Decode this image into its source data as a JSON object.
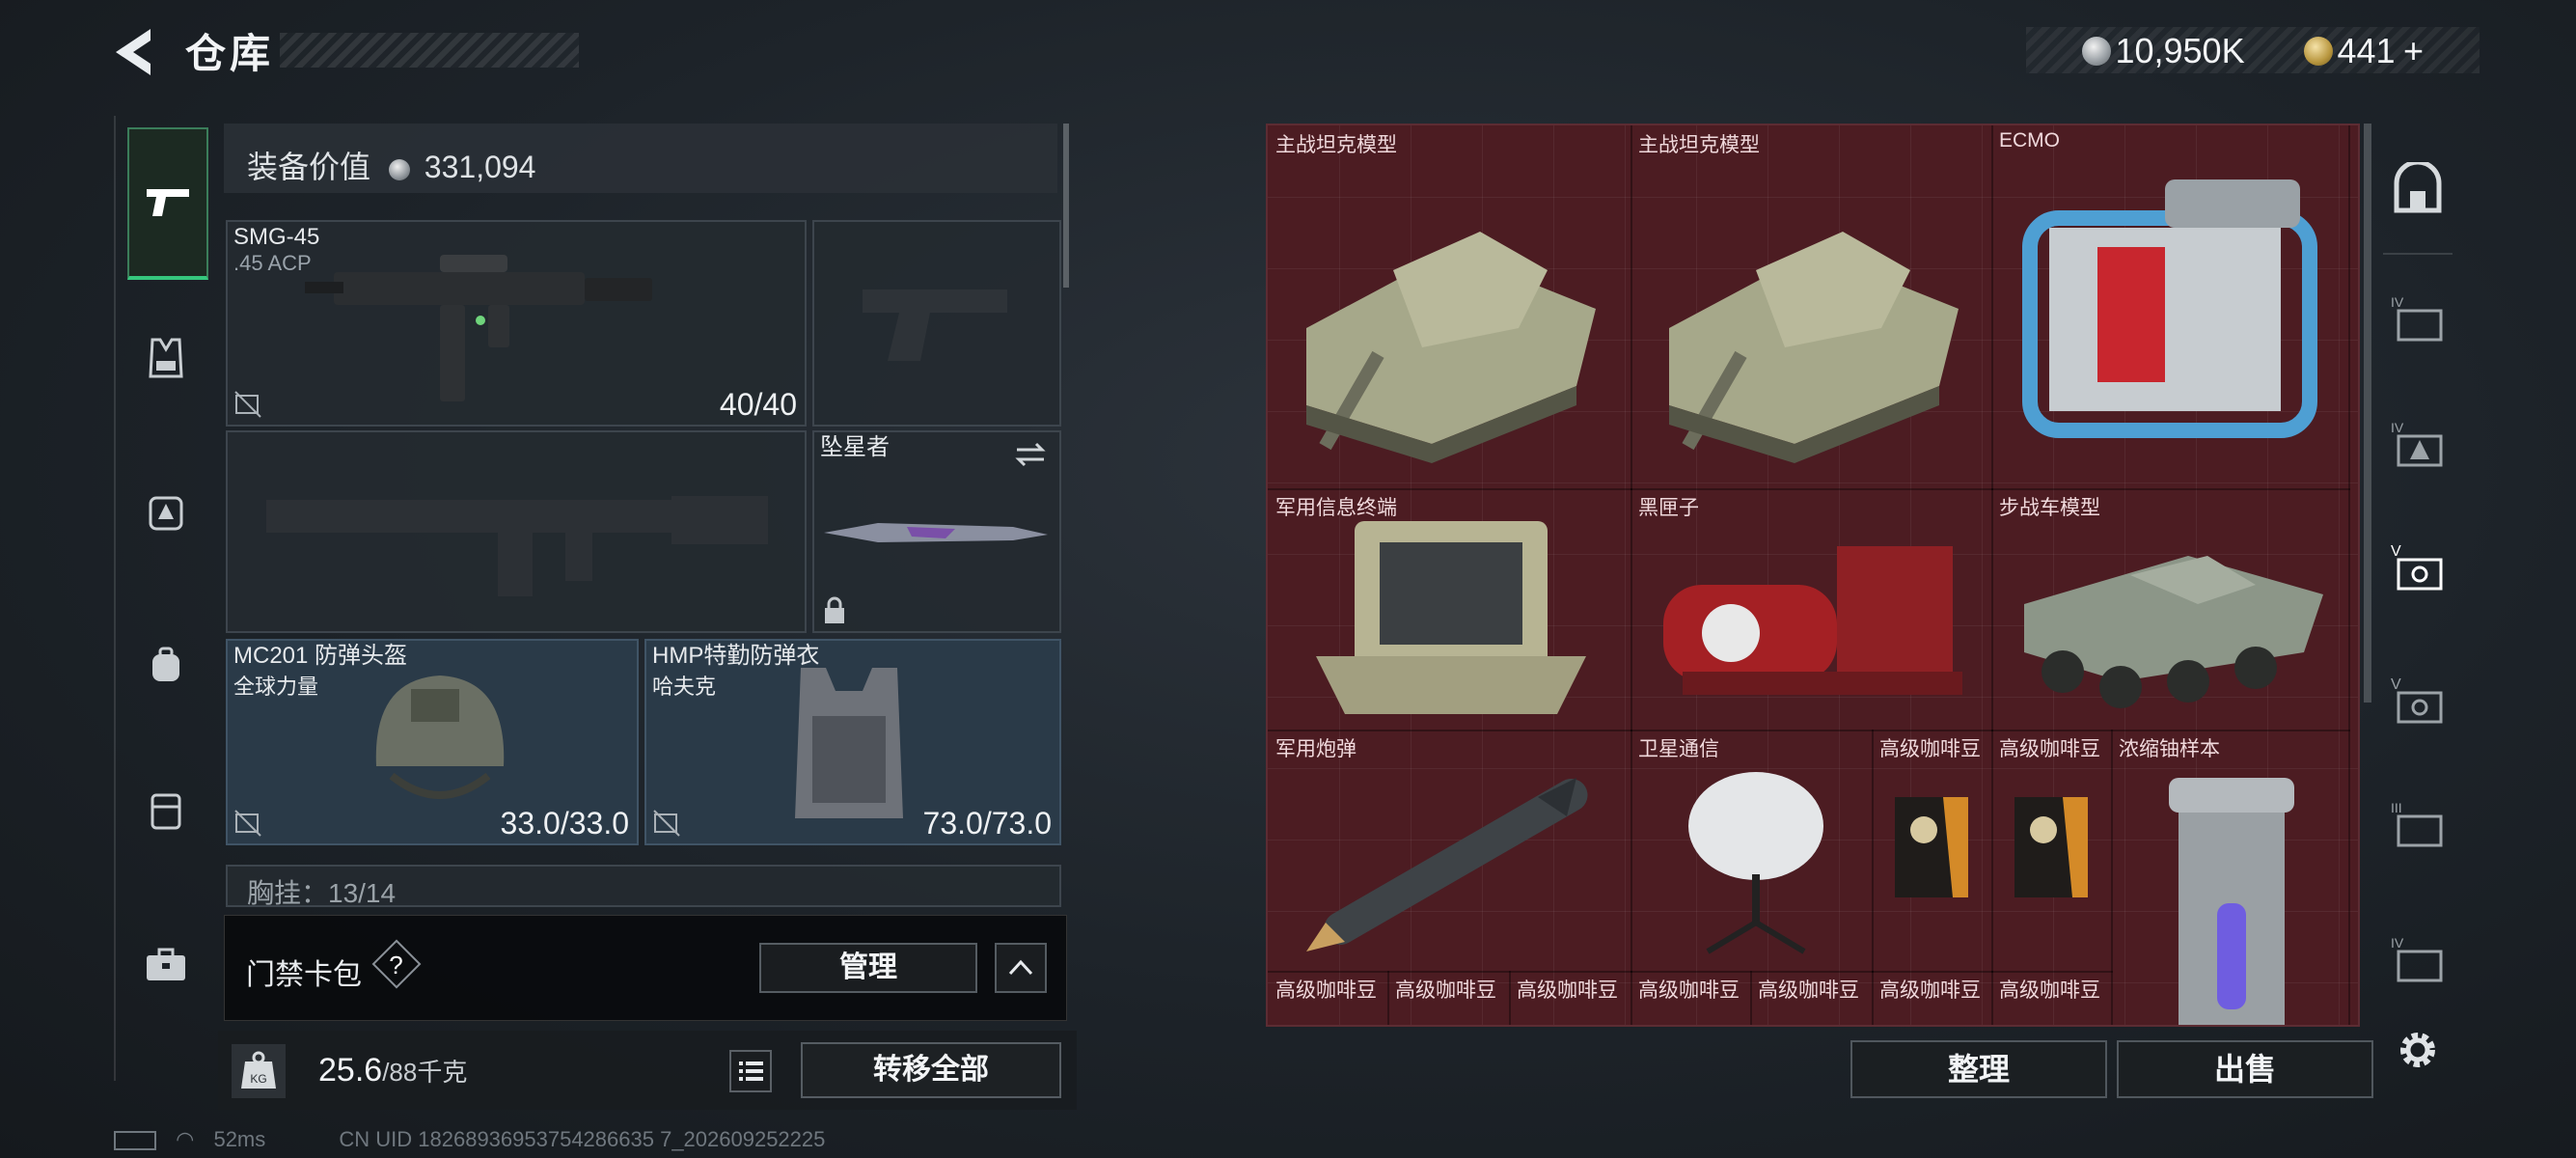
{
  "header": {
    "title": "仓库",
    "currencies": [
      {
        "icon": "silver-coin-icon",
        "value": "10,950K"
      },
      {
        "icon": "gold-triangle-coin-icon",
        "value": "441"
      }
    ],
    "add_label": "+"
  },
  "left_rail": {
    "items": [
      {
        "name": "pistol-icon",
        "active": true
      },
      {
        "name": "vest-icon"
      },
      {
        "name": "backpack-warning-icon"
      },
      {
        "name": "backpack-icon"
      },
      {
        "name": "container-icon"
      },
      {
        "name": "toolbox-icon"
      }
    ]
  },
  "equipment": {
    "value_label": "装备价值",
    "value": "331,094",
    "slots": {
      "primary": {
        "name": "SMG-45",
        "ammo": ".45 ACP",
        "durability": "40/40"
      },
      "melee": {
        "name": "坠星者"
      },
      "helmet": {
        "name": "MC201 防弹头盔",
        "sub": "全球力量",
        "durability": "33.0/33.0"
      },
      "armor": {
        "name": "HMP特勤防弹衣",
        "sub": "哈夫克",
        "durability": "73.0/73.0"
      }
    },
    "partial_row": "胸挂：13/14"
  },
  "gatepass": {
    "label": "门禁卡包",
    "help": "?",
    "manage_label": "管理"
  },
  "weight": {
    "current": "25.6",
    "max": "/88千克",
    "transfer_label": "转移全部"
  },
  "storage": {
    "items": [
      {
        "name": "主战坦克模型"
      },
      {
        "name": "主战坦克模型"
      },
      {
        "name": "ECMO"
      },
      {
        "name": "军用信息终端"
      },
      {
        "name": "黑匣子"
      },
      {
        "name": "步战车模型"
      },
      {
        "name": "军用炮弹"
      },
      {
        "name": "卫星通信"
      },
      {
        "name": "高级咖啡豆"
      },
      {
        "name": "高级咖啡豆"
      },
      {
        "name": "浓缩铀样本"
      }
    ],
    "bottom_row": [
      "高级咖啡豆",
      "高级咖啡豆",
      "高级咖啡豆",
      "高级咖啡豆",
      "高级咖啡豆",
      "高级咖啡豆",
      "高级咖啡豆"
    ],
    "sort_label": "整理",
    "sell_label": "出售"
  },
  "right_rail": {
    "items": [
      {
        "name": "vault-icon"
      },
      {
        "name": "case-tier-iv-icon"
      },
      {
        "name": "case-tier-iv-warning-icon"
      },
      {
        "name": "case-tier-v-icon",
        "active": true
      },
      {
        "name": "case-tier-v-icon"
      },
      {
        "name": "case-tier-iii-icon"
      },
      {
        "name": "case-tier-iv-icon"
      }
    ]
  },
  "status": {
    "ping": "52ms",
    "uid": "CN UID 18268936953754286635 7_202609252225"
  }
}
